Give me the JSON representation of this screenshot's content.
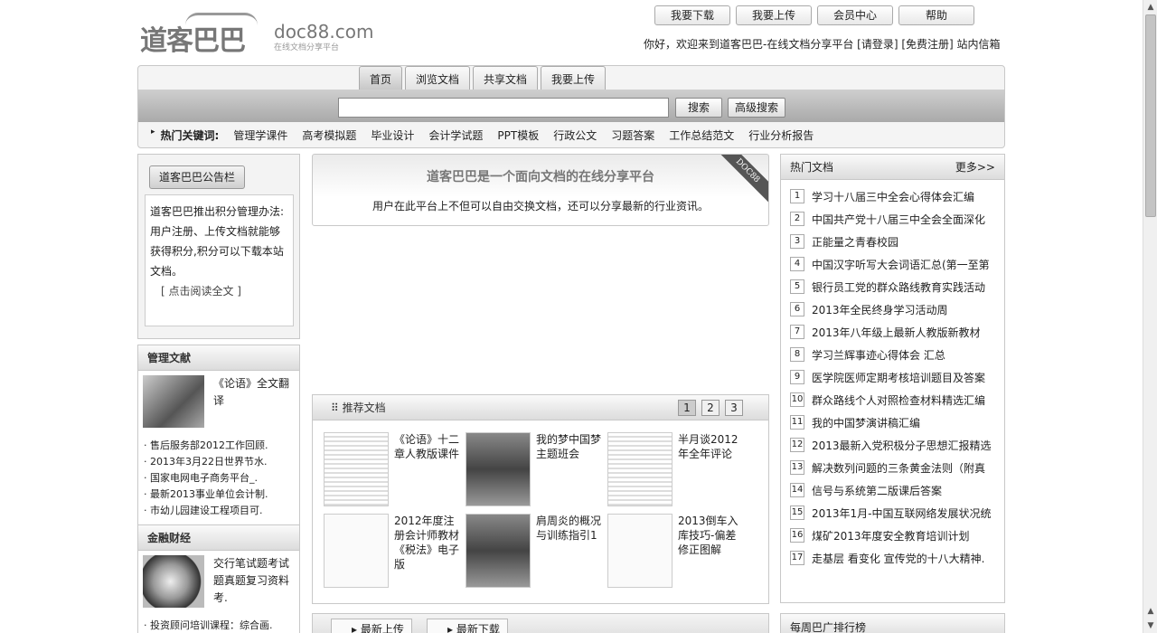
{
  "header": {
    "logo_cn": "道客巴巴",
    "logo_en": "doc88.com",
    "logo_sub": "在线文档分享平台",
    "top_buttons": [
      "我要下载",
      "我要上传",
      "会员中心",
      "帮助"
    ],
    "welcome": "你好，欢迎来到道客巴巴-在线文档分享平台 [请登录] [免费注册] 站内信箱"
  },
  "nav": {
    "tabs": [
      "首页",
      "浏览文档",
      "共享文档",
      "我要上传"
    ],
    "search_value": "",
    "search_button": "搜索",
    "advanced_button": "高级搜索",
    "hot_label": "热门关键词:",
    "hot_keywords": [
      "管理学课件",
      "高考模拟题",
      "毕业设计",
      "会计学试题",
      "PPT模板",
      "行政公文",
      "习题答案",
      "工作总结范文",
      "行业分析报告"
    ]
  },
  "notice": {
    "title": "道客巴巴公告栏",
    "text": "道客巴巴推出积分管理办法:用户注册、上传文档就能够获得积分,积分可以下载本站文档。",
    "more": "[ 点击阅读全文 ]"
  },
  "mgmt": {
    "title": "管理文献",
    "feature": "《论语》全文翻译",
    "items": [
      "售后服务部2012工作回顾.",
      "2013年3月22日世界节水.",
      "国家电网电子商务平台_.",
      "最新2013事业单位会计制.",
      "市幼儿园建设工程项目可."
    ]
  },
  "finance": {
    "title": "金融财经",
    "feature": "交行笔试题考试题真题复习资料考.",
    "items": [
      "投资顾问培训课程：综合画."
    ]
  },
  "intro": {
    "title": "道客巴巴是一个面向文档的在线分享平台",
    "text": "用户在此平台上不但可以自由交换文档，还可以分享最新的行业资讯。",
    "corner": "DOC88"
  },
  "recommend": {
    "title": "推荐文档",
    "pages": [
      "1",
      "2",
      "3"
    ],
    "docs": [
      "《论语》十二章人教版课件",
      "我的梦中国梦主题班会",
      "半月谈2012年全年评论",
      "2012年度注册会计师教材《税法》电子版",
      "肩周炎的概况与训练指引1",
      "2013倒车入库技巧-偏差修正图解"
    ]
  },
  "bottom_tabs": [
    "最新上传",
    "最新下载"
  ],
  "hot_docs": {
    "title": "热门文档",
    "more": "更多>>",
    "items": [
      "学习十八届三中全会心得体会汇编",
      "中国共产党十八届三中全会全面深化",
      "正能量之青春校园",
      "中国汉字听写大会词语汇总(第一至第",
      "银行员工党的群众路线教育实践活动",
      "2013年全民终身学习活动周",
      "2013年八年级上最新人教版新教材",
      "学习兰辉事迹心得体会 汇总",
      "医学院医师定期考核培训题目及答案",
      "群众路线个人对照检查材料精选汇编",
      "我的中国梦演讲稿汇编",
      "2013最新入党积极分子思想汇报精选",
      "解决数列问题的三条黄金法则（附真",
      "信号与系统第二版课后答案",
      "2013年1月-中国互联网络发展状况统",
      "煤矿2013年度安全教育培训计划",
      "走基层 看变化 宣传党的十八大精神."
    ]
  },
  "bottom_right": "每周巴广排行榜"
}
